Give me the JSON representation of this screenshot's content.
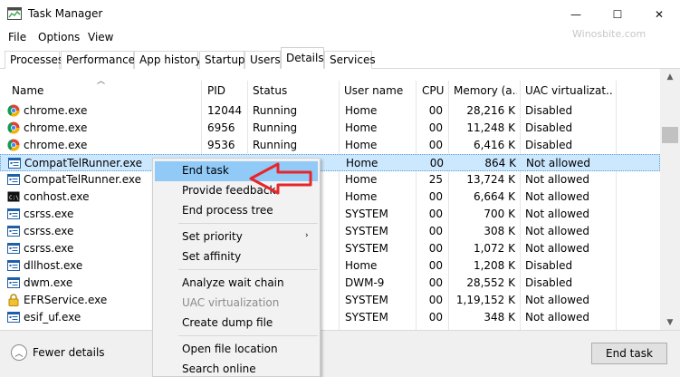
{
  "window": {
    "title": "Task Manager",
    "watermark": "Winosbite.com",
    "minimize": "—",
    "maximize": "☐",
    "close": "✕"
  },
  "menu": [
    "File",
    "Options",
    "View"
  ],
  "tabs": [
    "Processes",
    "Performance",
    "App history",
    "Startup",
    "Users",
    "Details",
    "Services"
  ],
  "active_tab": "Details",
  "columns": {
    "name": "Name",
    "pid": "PID",
    "status": "Status",
    "user": "User name",
    "cpu": "CPU",
    "memory": "Memory (a...",
    "uac": "UAC virtualizat..."
  },
  "rows": [
    {
      "name": "chrome.exe",
      "pid": "12044",
      "status": "Running",
      "user": "Home",
      "cpu": "00",
      "memory": "28,216 K",
      "uac": "Disabled",
      "icon": "chrome-icon"
    },
    {
      "name": "chrome.exe",
      "pid": "6956",
      "status": "Running",
      "user": "Home",
      "cpu": "00",
      "memory": "11,248 K",
      "uac": "Disabled",
      "icon": "chrome-icon"
    },
    {
      "name": "chrome.exe",
      "pid": "9536",
      "status": "Running",
      "user": "Home",
      "cpu": "00",
      "memory": "6,416 K",
      "uac": "Disabled",
      "icon": "chrome-icon"
    },
    {
      "name": "CompatTelRunner.exe",
      "pid": "",
      "status": "",
      "user": "Home",
      "cpu": "00",
      "memory": "864 K",
      "uac": "Not allowed",
      "icon": "app-window-icon"
    },
    {
      "name": "CompatTelRunner.exe",
      "pid": "",
      "status": "",
      "user": "Home",
      "cpu": "25",
      "memory": "13,724 K",
      "uac": "Not allowed",
      "icon": "app-window-icon"
    },
    {
      "name": "conhost.exe",
      "pid": "",
      "status": "",
      "user": "Home",
      "cpu": "00",
      "memory": "6,664 K",
      "uac": "Not allowed",
      "icon": "console-icon"
    },
    {
      "name": "csrss.exe",
      "pid": "",
      "status": "",
      "user": "SYSTEM",
      "cpu": "00",
      "memory": "700 K",
      "uac": "Not allowed",
      "icon": "app-window-icon"
    },
    {
      "name": "csrss.exe",
      "pid": "",
      "status": "",
      "user": "SYSTEM",
      "cpu": "00",
      "memory": "308 K",
      "uac": "Not allowed",
      "icon": "app-window-icon"
    },
    {
      "name": "csrss.exe",
      "pid": "",
      "status": "",
      "user": "SYSTEM",
      "cpu": "00",
      "memory": "1,072 K",
      "uac": "Not allowed",
      "icon": "app-window-icon"
    },
    {
      "name": "dllhost.exe",
      "pid": "",
      "status": "",
      "user": "Home",
      "cpu": "00",
      "memory": "1,208 K",
      "uac": "Disabled",
      "icon": "app-window-icon"
    },
    {
      "name": "dwm.exe",
      "pid": "",
      "status": "",
      "user": "DWM-9",
      "cpu": "00",
      "memory": "28,552 K",
      "uac": "Disabled",
      "icon": "app-window-icon"
    },
    {
      "name": "EFRService.exe",
      "pid": "",
      "status": "",
      "user": "SYSTEM",
      "cpu": "00",
      "memory": "1,19,152 K",
      "uac": "Not allowed",
      "icon": "lock-icon"
    },
    {
      "name": "esif_uf.exe",
      "pid": "",
      "status": "",
      "user": "SYSTEM",
      "cpu": "00",
      "memory": "348 K",
      "uac": "Not allowed",
      "icon": "app-window-icon"
    }
  ],
  "selected_row": 3,
  "context_menu": {
    "items": [
      {
        "label": "End task",
        "highlighted": true
      },
      {
        "label": "Provide feedback"
      },
      {
        "label": "End process tree"
      },
      {
        "label": "Set priority",
        "submenu": true
      },
      {
        "label": "Set affinity"
      },
      {
        "label": "Analyze wait chain"
      },
      {
        "label": "UAC virtualization",
        "disabled": true
      },
      {
        "label": "Create dump file"
      },
      {
        "label": "Open file location"
      },
      {
        "label": "Search online"
      }
    ],
    "submenu_arrow": "›"
  },
  "footer": {
    "fewer_details": "Fewer details",
    "end_task": "End task"
  },
  "colors": {
    "selection": "#cce8ff",
    "menu_highlight": "#91c9f7",
    "annotation_arrow": "#e8262a"
  }
}
